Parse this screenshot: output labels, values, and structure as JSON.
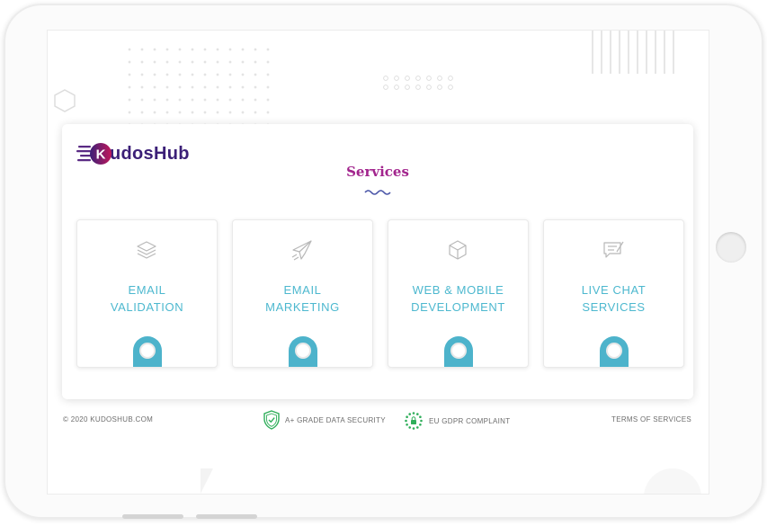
{
  "brand": {
    "name_initial": "K",
    "name_rest": "udosHub"
  },
  "section": {
    "title": "Services"
  },
  "services": [
    {
      "line1": "EMAIL",
      "line2": "VALIDATION",
      "icon": "layers-icon"
    },
    {
      "line1": "EMAIL",
      "line2": "MARKETING",
      "icon": "paper-plane-icon"
    },
    {
      "line1": "WEB & MOBILE",
      "line2": "DEVELOPMENT",
      "icon": "cube-icon"
    },
    {
      "line1": "LIVE CHAT",
      "line2": "SERVICES",
      "icon": "chat-icon"
    }
  ],
  "footer": {
    "copyright": "© 2020 KUDOSHUB.COM",
    "security": "A+ GRADE DATA SECURITY",
    "gdpr": "EU GDPR COMPLAINT",
    "terms": "TERMS OF SERVICES"
  },
  "colors": {
    "accent": "#4db8cf",
    "title": "#a2248d",
    "brand": "#3b1f77",
    "tab": "#4db3cb",
    "badge_green": "#2fae5a"
  }
}
